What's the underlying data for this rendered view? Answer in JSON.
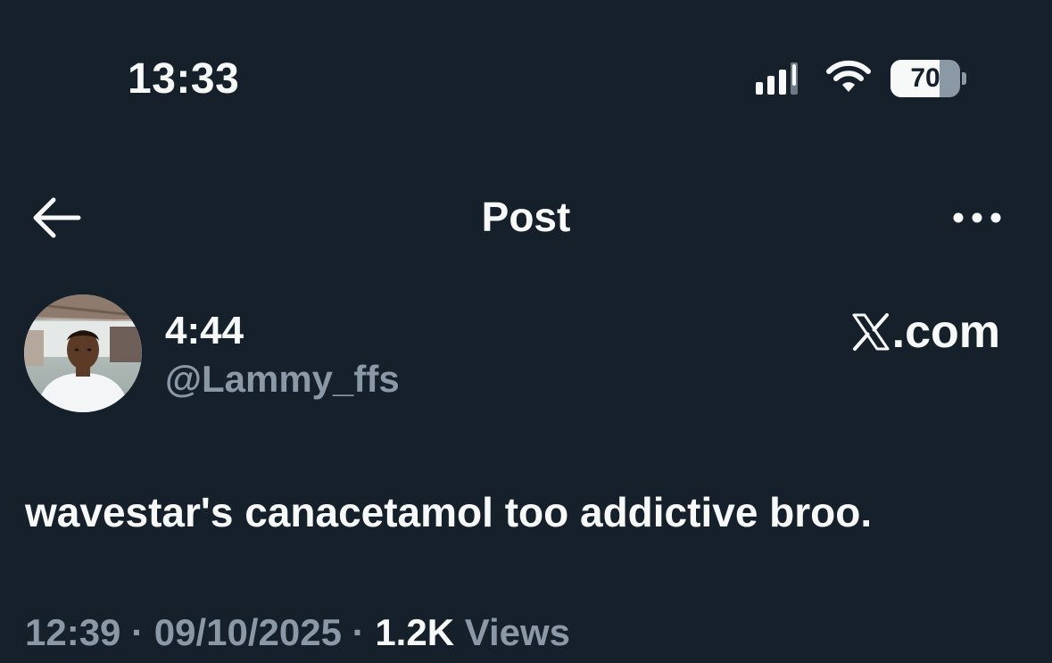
{
  "status_bar": {
    "time": "13:33",
    "battery_percent": "70",
    "battery_level": 0.7,
    "signal_icon": "cellular-signal-icon",
    "wifi_icon": "wifi-icon"
  },
  "header": {
    "title": "Post",
    "back_icon": "arrow-left-icon",
    "more_icon": "more-horizontal-icon"
  },
  "post": {
    "author_name": "4:44",
    "author_handle": "@Lammy_ffs",
    "source_label": ".com",
    "source_icon": "x-logo-icon",
    "text": "wavestar's canacetamol too addictive broo.",
    "time": "12:39",
    "separator": "·",
    "date": "09/10/2025",
    "views_count": "1.2K",
    "views_label": "Views"
  },
  "colors": {
    "background": "#15202b",
    "primary_text": "#f7f9f9",
    "secondary_text": "#8b98a5"
  }
}
